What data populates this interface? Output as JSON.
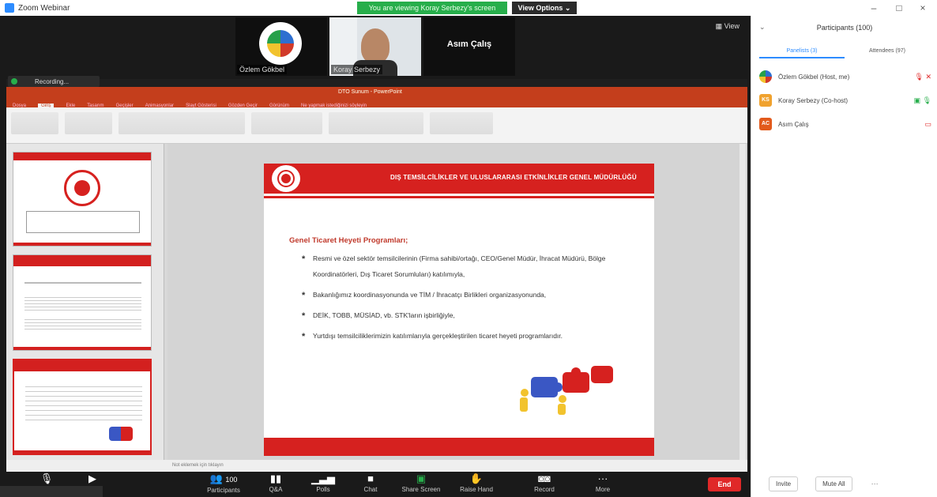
{
  "window": {
    "title": "Zoom Webinar"
  },
  "banner": {
    "text": "You are viewing Koray Serbezy's screen"
  },
  "view_options": {
    "label": "View Options ⌄"
  },
  "gallery": {
    "tiles": [
      {
        "name": "Özlem Gökbel"
      },
      {
        "name": "Koray Serbezy"
      },
      {
        "name": "Asım Çalış"
      }
    ],
    "view_label": "View"
  },
  "share_badge": {
    "label": "Recording..."
  },
  "ppt": {
    "title": "DTO Sunum - PowerPoint",
    "tabs": [
      "Dosya",
      "Giriş",
      "Ekle",
      "Tasarım",
      "Geçişler",
      "Animasyonlar",
      "Slayt Gösterisi",
      "Gözden Geçir",
      "Görünüm",
      "Ne yapmak istediğinizi söyleyin"
    ],
    "status": "Not eklemek için tıklayın",
    "slide": {
      "header": "DIŞ TEMSİLCİLİKLER VE ULUSLARARASI ETKİNLİKLER GENEL MÜDÜRLÜĞÜ",
      "subtitle": "Genel Ticaret Heyeti Programları;",
      "bullets": [
        "Resmi ve özel sektör temsilcilerinin (Firma sahibi/ortağı, CEO/Genel Müdür, İhracat Müdürü, Bölge Koordinatörleri, Dış Ticaret Sorumluları) katılımıyla,",
        "Bakanlığımız koordinasyonunda ve TİM / İhracatçı Birlikleri organizasyonunda,",
        "DEİK, TOBB, MÜSİAD, vb. STK'ların işbirliğiyle,",
        "Yurtdışı temsilciliklerimizin katılımlarıyla gerçekleştirilen ticaret heyeti programlarıdır."
      ]
    }
  },
  "toolbar": {
    "participants_count": "100",
    "buttons": [
      "Participants",
      "Q&A",
      "Polls",
      "Chat",
      "Share Screen",
      "Raise Hand",
      "Record",
      "More"
    ],
    "end": "End"
  },
  "panel": {
    "title": "Participants (100)",
    "tabs": [
      "Panelists (3)",
      "Attendees (97)"
    ],
    "participants": [
      {
        "name": "Özlem Gökbel (Host, me)",
        "initials": "",
        "color": "#3b6bd6"
      },
      {
        "name": "Koray Serbezy (Co-host)",
        "initials": "KS",
        "color": "#f0a22e"
      },
      {
        "name": "Asım Çalış",
        "initials": "AC",
        "color": "#e25a1c"
      }
    ],
    "footer": [
      "Invite",
      "Mute All"
    ]
  },
  "colors": {
    "accent": "#2d8cff",
    "ppt_red": "#c43e1c",
    "slide_red": "#d6211f",
    "end_red": "#e02828"
  }
}
